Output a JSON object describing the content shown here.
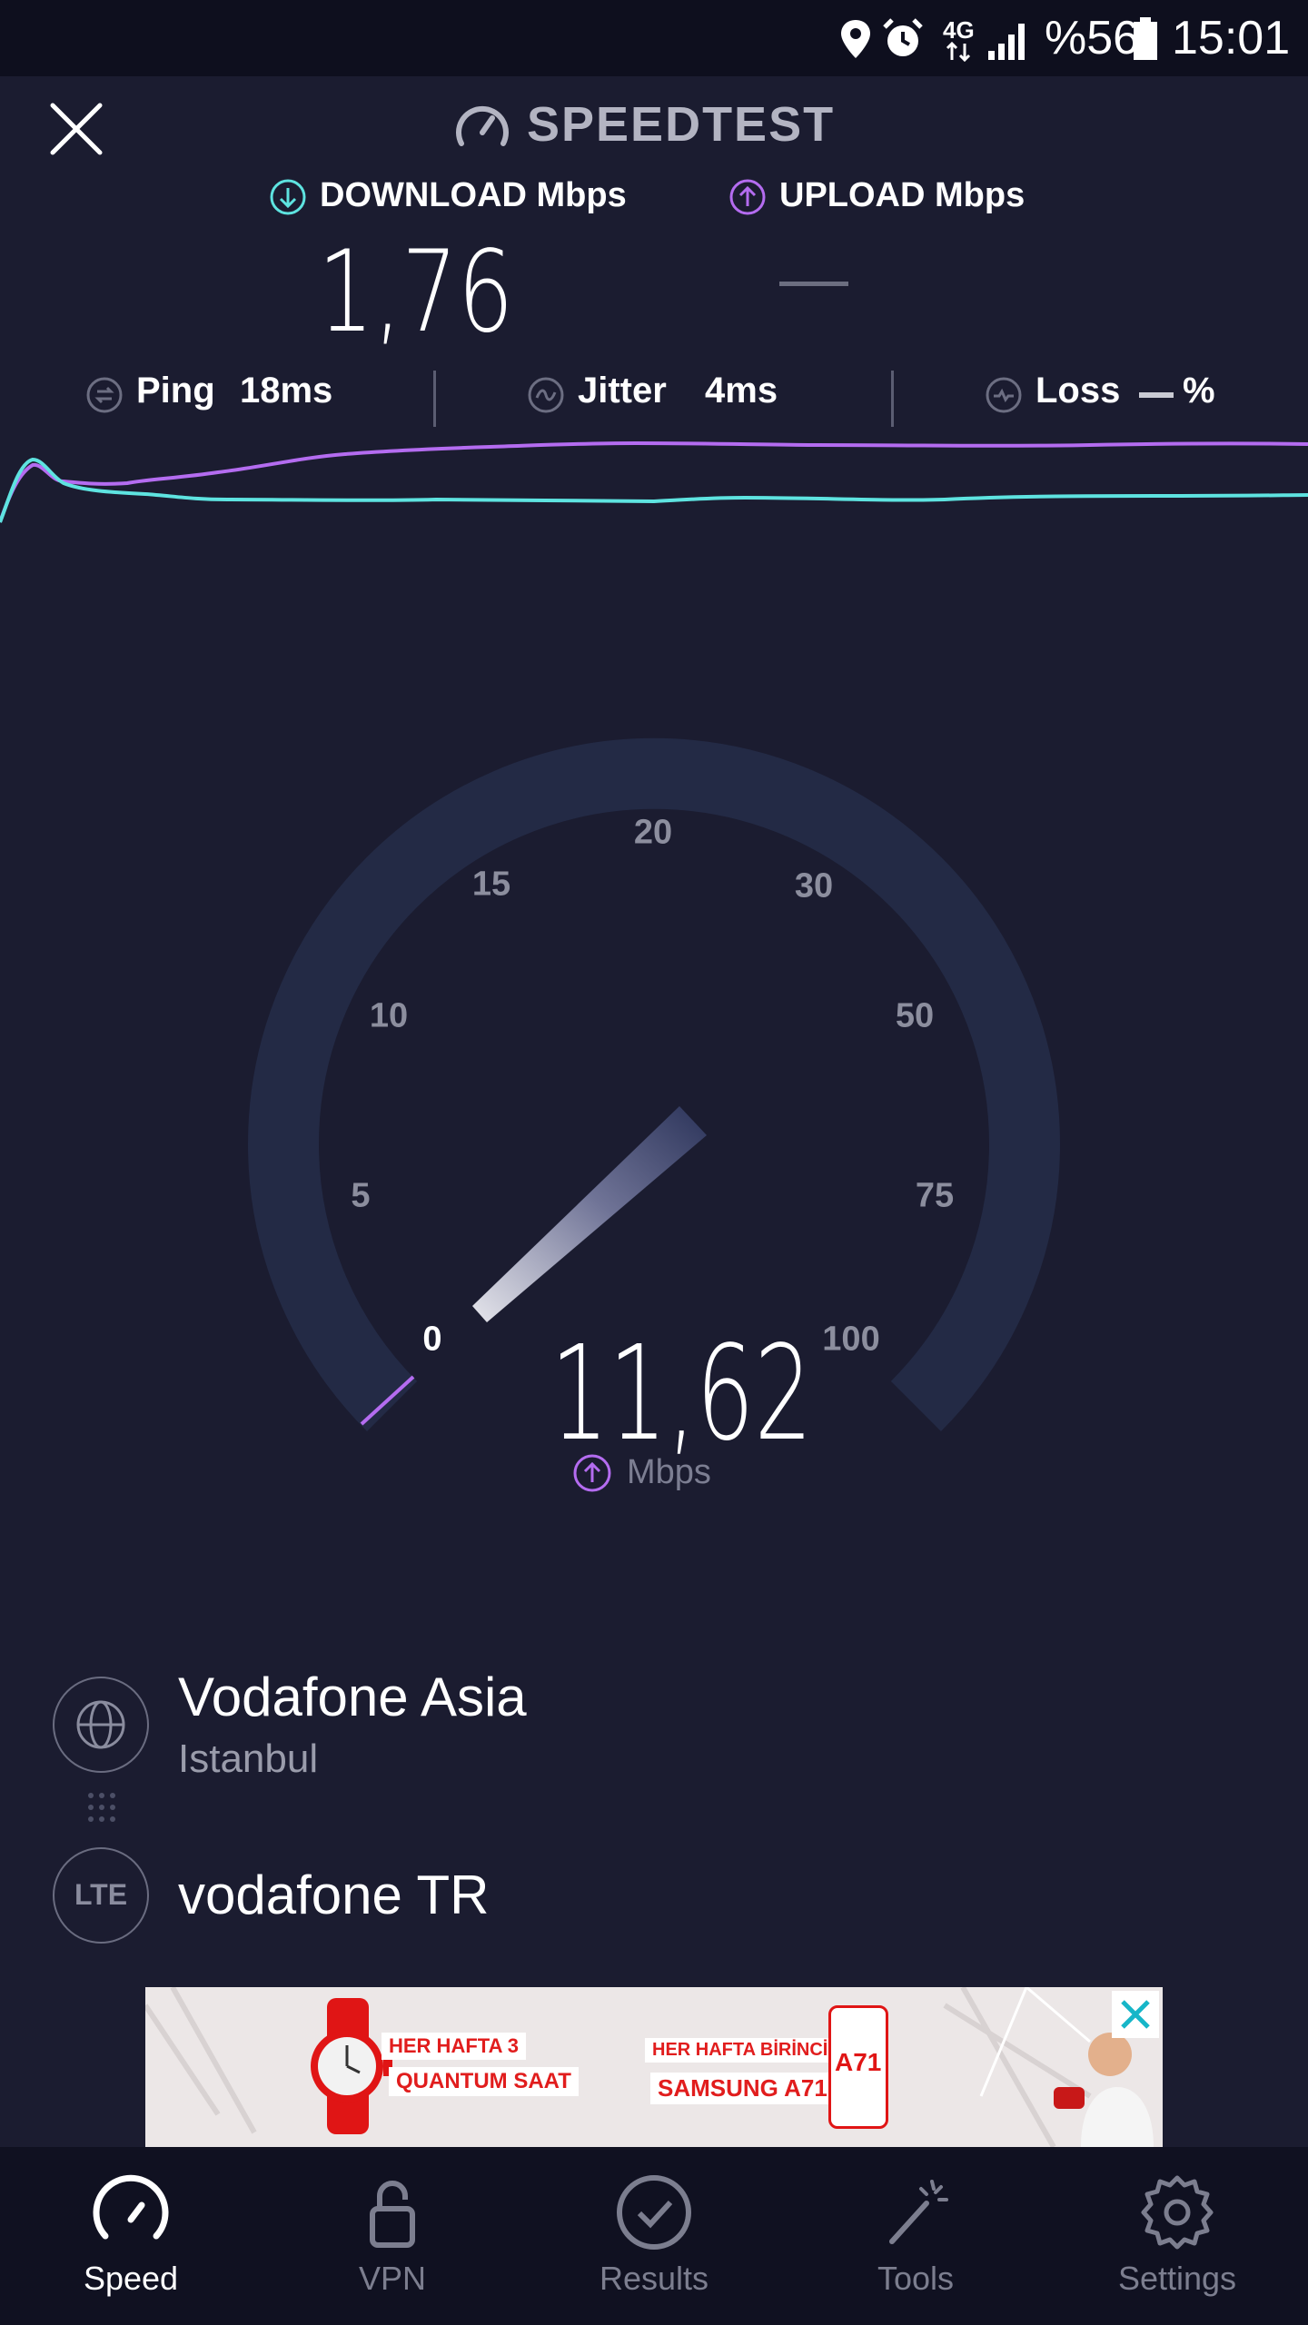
{
  "status_bar": {
    "battery_text": "%56",
    "time": "15:01",
    "network": "4G",
    "icons": [
      "location-icon",
      "alarm-icon",
      "network-4g-icon",
      "signal-icon",
      "battery-icon"
    ]
  },
  "header": {
    "title": "SPEEDTEST",
    "close_icon": "close-icon",
    "download_label": "DOWNLOAD Mbps",
    "upload_label": "UPLOAD Mbps",
    "download_value": "1,76",
    "upload_value": "—"
  },
  "stats": {
    "ping_label": "Ping",
    "ping_value": "18ms",
    "jitter_label": "Jitter",
    "jitter_value": "4ms",
    "loss_label": "Loss",
    "loss_value": "%"
  },
  "graph": {
    "upload_color": "#b46cf0",
    "download_color": "#5ee3e0"
  },
  "gauge": {
    "labels": [
      "0",
      "5",
      "10",
      "15",
      "20",
      "30",
      "50",
      "75",
      "100"
    ],
    "value": "11,62",
    "unit": "Mbps",
    "current_value_mbps": 11.62,
    "accent_color": "#b46cf0"
  },
  "server": {
    "host": "Vodafone Asia",
    "city": "Istanbul",
    "provider": "vodafone TR",
    "provider_badge": "LTE"
  },
  "ad": {
    "left_line1": "HER HAFTA 3",
    "left_line2": "QUANTUM SAAT",
    "mid_line1": "HER HAFTA BİRİNCİYE",
    "mid_line2": "SAMSUNG A71",
    "phone_label": "A71"
  },
  "nav": {
    "items": [
      {
        "label": "Speed",
        "icon": "speed-icon",
        "active": true
      },
      {
        "label": "VPN",
        "icon": "lock-icon",
        "active": false
      },
      {
        "label": "Results",
        "icon": "check-circle-icon",
        "active": false
      },
      {
        "label": "Tools",
        "icon": "wand-icon",
        "active": false
      },
      {
        "label": "Settings",
        "icon": "gear-icon",
        "active": false
      }
    ]
  },
  "colors": {
    "background": "#1b1c30",
    "gauge_track": "#232a45",
    "download": "#5ee3e0",
    "upload": "#b46cf0"
  }
}
